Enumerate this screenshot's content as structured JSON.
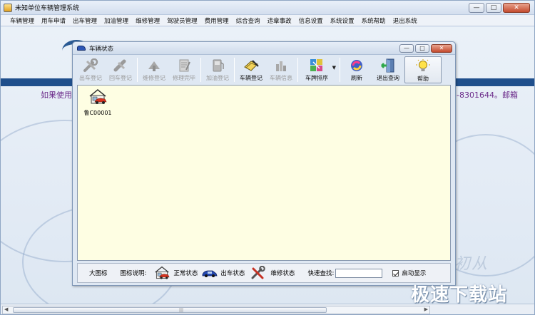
{
  "main": {
    "title": "未知单位车辆管理系统",
    "controls": {
      "minimize": "—",
      "maximize": "□",
      "close": "✕"
    }
  },
  "menu": {
    "items": [
      "车辆管理",
      "用车申请",
      "出车管理",
      "加油管理",
      "维修管理",
      "驾驶员管理",
      "费用管理",
      "综合查询",
      "违章事故",
      "信息设置",
      "系统设置",
      "系统帮助",
      "退出系统"
    ]
  },
  "background": {
    "text_left": "如果使用",
    "text_right": "3-8301644。邮箱",
    "brand_fragment": "初从"
  },
  "child": {
    "title": "车辆状态",
    "controls": {
      "minimize": "—",
      "maximize": "□",
      "close": "✕"
    },
    "toolbar": {
      "depart": "出车登记",
      "return": "回车登记",
      "repair_register": "维修登记",
      "repair_done": "修理完毕",
      "refuel": "加油登记",
      "vehicle_register": "车辆登记",
      "vehicle_info": "车辆信息",
      "plate_sort": "车牌排序",
      "refresh": "刷新",
      "exit_query": "退出查询",
      "help": "帮助"
    },
    "vehicles": [
      {
        "plate": "鲁C00001"
      }
    ],
    "legend": {
      "view_mode": "大图标",
      "legend_label": "图标说明:",
      "normal": "正常状态",
      "out": "出车状态",
      "repair": "维修状态",
      "quick_search": "快速查找:",
      "search_value": "",
      "autoshow": "启动显示"
    }
  },
  "watermark": "极速下载站",
  "colors": {
    "band": "#1f4f8c",
    "canvas_bg": "#fefee3",
    "purple_text": "#6b2a8a",
    "close_red": "#c44a2e"
  }
}
